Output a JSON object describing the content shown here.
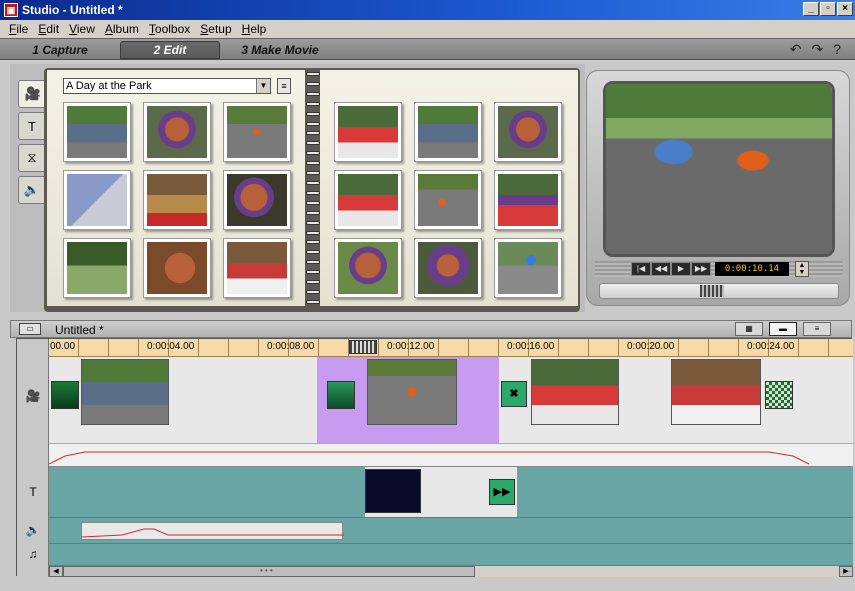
{
  "window": {
    "title": "Studio - Untitled *",
    "controls": [
      "_",
      "▫",
      "×"
    ]
  },
  "menu": [
    "File",
    "Edit",
    "View",
    "Album",
    "Toolbox",
    "Setup",
    "Help"
  ],
  "tabs": [
    "1 Capture",
    "2 Edit",
    "3 Make Movie"
  ],
  "active_tab": "2 Edit",
  "tab_tools": {
    "undo": "↶",
    "redo": "↷",
    "help": "?"
  },
  "album": {
    "selected_scene": "A Day at the Park"
  },
  "player": {
    "timecode": "0:00:10.14"
  },
  "movie": {
    "title": "Untitled *"
  },
  "timeline": {
    "ruler_labels": [
      "00.00",
      "0:00:04.00",
      "0:00:08.00",
      "0:00:12.00",
      "0:00:16.00",
      "0:00:20.00",
      "0:00:24.00"
    ],
    "scroll_dots": "• • •"
  },
  "colors": {
    "ruler": "#f5d9a6",
    "track": "#6aa5a5",
    "selection": "#c79bf0",
    "timecode": "#f5c000"
  }
}
